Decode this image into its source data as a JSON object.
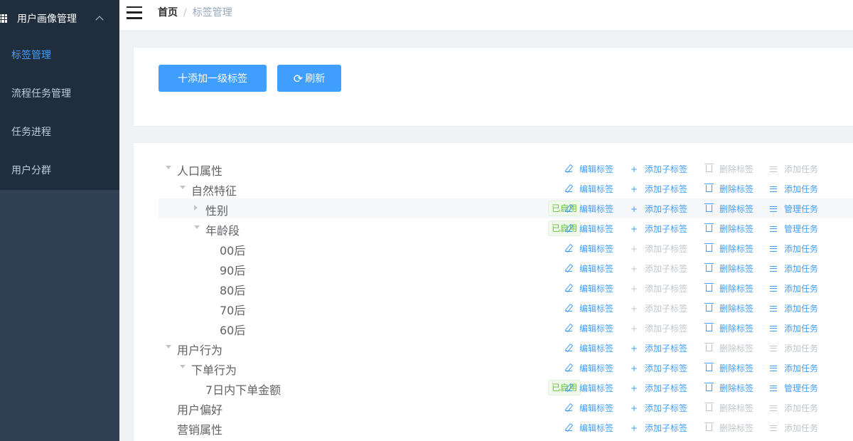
{
  "sidebar": {
    "menu_title": "用户画像管理",
    "items": [
      {
        "label": "标签管理",
        "active": true
      },
      {
        "label": "流程任务管理",
        "active": false
      },
      {
        "label": "任务进程",
        "active": false
      },
      {
        "label": "用户分群",
        "active": false
      }
    ]
  },
  "breadcrumb": {
    "home": "首页",
    "separator": "/",
    "current": "标签管理"
  },
  "toolbar": {
    "add_label": "十添加一级标签",
    "refresh_label": "刷新"
  },
  "colors": {
    "primary": "#409eff",
    "sidebar": "#304156",
    "sidebar_dark": "#1f2d3d",
    "success": "#67c23a",
    "disabled": "#c0c4cc"
  },
  "actions": {
    "edit": "编辑标签",
    "add_child": "添加子标签",
    "delete": "删除标签",
    "add_task": "添加任务",
    "manage_task": "管理任务"
  },
  "tree": [
    {
      "label": "人口属性",
      "level": 0,
      "caret": "down",
      "badge": "",
      "child_enabled": true,
      "delete_enabled": false,
      "task": "add_task",
      "task_enabled": false
    },
    {
      "label": "自然特征",
      "level": 1,
      "caret": "down",
      "badge": "",
      "child_enabled": true,
      "delete_enabled": true,
      "task": "add_task",
      "task_enabled": true
    },
    {
      "label": "性别",
      "level": 2,
      "caret": "right",
      "badge": "已启用",
      "child_enabled": true,
      "delete_enabled": true,
      "task": "manage_task",
      "task_enabled": true,
      "highlight": true
    },
    {
      "label": "年龄段",
      "level": 2,
      "caret": "down",
      "badge": "已启用",
      "child_enabled": true,
      "delete_enabled": true,
      "task": "manage_task",
      "task_enabled": true
    },
    {
      "label": "00后",
      "level": 3,
      "caret": "",
      "badge": "",
      "child_enabled": false,
      "delete_enabled": true,
      "task": "add_task",
      "task_enabled": true
    },
    {
      "label": "90后",
      "level": 3,
      "caret": "",
      "badge": "",
      "child_enabled": false,
      "delete_enabled": true,
      "task": "add_task",
      "task_enabled": true
    },
    {
      "label": "80后",
      "level": 3,
      "caret": "",
      "badge": "",
      "child_enabled": false,
      "delete_enabled": true,
      "task": "add_task",
      "task_enabled": true
    },
    {
      "label": "70后",
      "level": 3,
      "caret": "",
      "badge": "",
      "child_enabled": false,
      "delete_enabled": true,
      "task": "add_task",
      "task_enabled": true
    },
    {
      "label": "60后",
      "level": 3,
      "caret": "",
      "badge": "",
      "child_enabled": false,
      "delete_enabled": true,
      "task": "add_task",
      "task_enabled": true
    },
    {
      "label": "用户行为",
      "level": 0,
      "caret": "down",
      "badge": "",
      "child_enabled": true,
      "delete_enabled": false,
      "task": "add_task",
      "task_enabled": false
    },
    {
      "label": "下单行为",
      "level": 1,
      "caret": "down",
      "badge": "",
      "child_enabled": true,
      "delete_enabled": true,
      "task": "add_task",
      "task_enabled": true
    },
    {
      "label": "7日内下单金额",
      "level": 2,
      "caret": "",
      "badge": "已启用",
      "child_enabled": true,
      "delete_enabled": true,
      "task": "manage_task",
      "task_enabled": true
    },
    {
      "label": "用户偏好",
      "level": 0,
      "caret": "",
      "badge": "",
      "child_enabled": true,
      "delete_enabled": false,
      "task": "add_task",
      "task_enabled": false
    },
    {
      "label": "营销属性",
      "level": 0,
      "caret": "",
      "badge": "",
      "child_enabled": true,
      "delete_enabled": false,
      "task": "add_task",
      "task_enabled": false
    }
  ]
}
